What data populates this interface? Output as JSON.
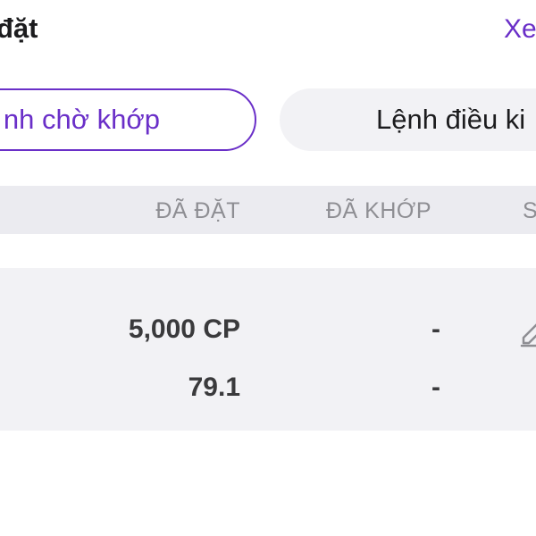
{
  "header": {
    "title": "đặt",
    "link_label": "Xe"
  },
  "tabs": [
    {
      "label": "nh chờ khớp",
      "active": true
    },
    {
      "label": "Lệnh điều ki",
      "active": false
    }
  ],
  "table": {
    "columns": [
      "ĐÃ ĐẶT",
      "ĐÃ KHỚP",
      "S"
    ],
    "rows": [
      {
        "placed_quantity": "5,000 CP",
        "placed_price": "79.1",
        "matched_quantity": "-",
        "matched_price": "-",
        "action_icon": "edit-icon"
      }
    ]
  },
  "colors": {
    "accent": "#6a2fc8",
    "header_bg": "#ebebf0",
    "row_bg": "#f2f2f5",
    "muted_text": "#8e8e93"
  }
}
